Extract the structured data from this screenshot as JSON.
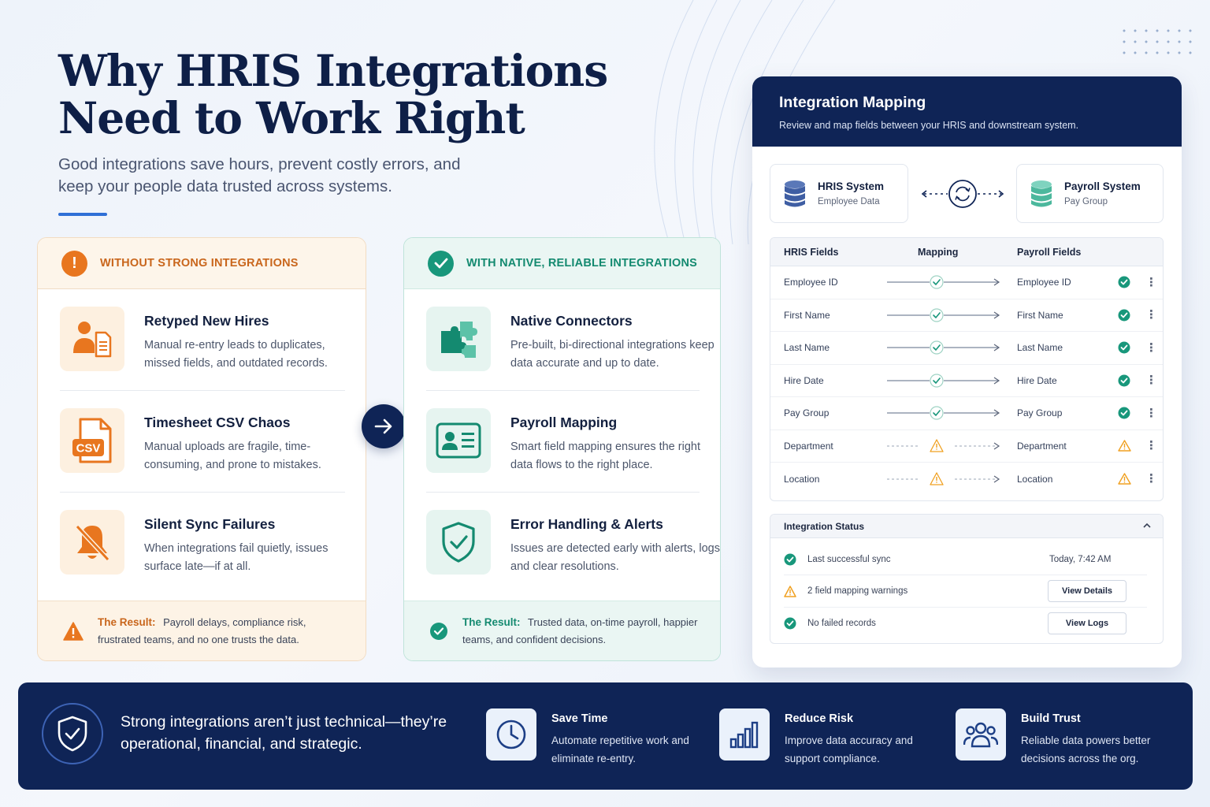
{
  "header": {
    "title": "Why HRIS Integrations Need to Work Right",
    "subtitle": "Good integrations save hours, prevent costly errors, and keep your people data trusted across systems."
  },
  "colors": {
    "navy": "#0f2456",
    "orange": "#e8761f",
    "teal": "#18977b",
    "accent_blue": "#2f6fd6"
  },
  "without": {
    "heading": "WITHOUT STRONG INTEGRATIONS",
    "icon": "exclamation-icon",
    "items": [
      {
        "title": "Retyped New Hires",
        "desc": "Manual re-entry leads to duplicates, missed fields, and outdated records.",
        "icon": "person-document-icon"
      },
      {
        "title": "Timesheet CSV Chaos",
        "desc": "Manual uploads are fragile, time-consuming, and prone to mistakes.",
        "icon": "csv-file-icon",
        "icon_text": "CSV"
      },
      {
        "title": "Silent Sync Failures",
        "desc": "When integrations fail quietly, issues surface late—if at all.",
        "icon": "muted-bell-icon"
      }
    ],
    "result_label": "The Result:",
    "result_text": "Payroll delays, compliance risk, frustrated teams, and no one trusts the data."
  },
  "with": {
    "heading": "WITH NATIVE, RELIABLE INTEGRATIONS",
    "icon": "check-circle-icon",
    "items": [
      {
        "title": "Native Connectors",
        "desc": "Pre-built, bi-directional integrations keep data accurate and up to date.",
        "icon": "puzzle-icon"
      },
      {
        "title": "Payroll Mapping",
        "desc": "Smart field mapping ensures the right data flows to the right place.",
        "icon": "id-card-icon"
      },
      {
        "title": "Error Handling & Alerts",
        "desc": "Issues are detected early with alerts, logs, and clear resolutions.",
        "icon": "shield-check-icon"
      }
    ],
    "result_label": "The Result:",
    "result_text": "Trusted data, on-time payroll, happier teams, and confident decisions."
  },
  "mapping": {
    "title": "Integration Mapping",
    "subtitle": "Review and map fields between your HRIS and downstream system.",
    "source": {
      "name": "HRIS System",
      "sub": "Employee Data"
    },
    "target": {
      "name": "Payroll System",
      "sub": "Pay Group"
    },
    "columns": [
      "HRIS Fields",
      "Mapping",
      "Payroll Fields"
    ],
    "rows": [
      {
        "from": "Employee ID",
        "to": "Employee ID",
        "status": "ok"
      },
      {
        "from": "First Name",
        "to": "First Name",
        "status": "ok"
      },
      {
        "from": "Last Name",
        "to": "Last Name",
        "status": "ok"
      },
      {
        "from": "Hire Date",
        "to": "Hire Date",
        "status": "ok"
      },
      {
        "from": "Pay Group",
        "to": "Pay Group",
        "status": "ok"
      },
      {
        "from": "Department",
        "to": "Department",
        "status": "warn"
      },
      {
        "from": "Location",
        "to": "Location",
        "status": "warn"
      }
    ],
    "status": {
      "title": "Integration Status",
      "last_sync_label": "Last successful sync",
      "last_sync_value": "Today, 7:42 AM",
      "warnings_label": "2 field mapping warnings",
      "warnings_button": "View Details",
      "failed_label": "No failed records",
      "failed_button": "View Logs"
    }
  },
  "banner": {
    "tagline": "Strong integrations aren’t just technical—they’re operational, financial, and strategic.",
    "benefits": [
      {
        "title": "Save Time",
        "desc": "Automate repetitive work and eliminate re-entry.",
        "icon": "clock-icon"
      },
      {
        "title": "Reduce Risk",
        "desc": "Improve data accuracy and support compliance.",
        "icon": "bar-chart-icon"
      },
      {
        "title": "Build Trust",
        "desc": "Reliable data powers better decisions across the org.",
        "icon": "people-icon"
      }
    ]
  }
}
